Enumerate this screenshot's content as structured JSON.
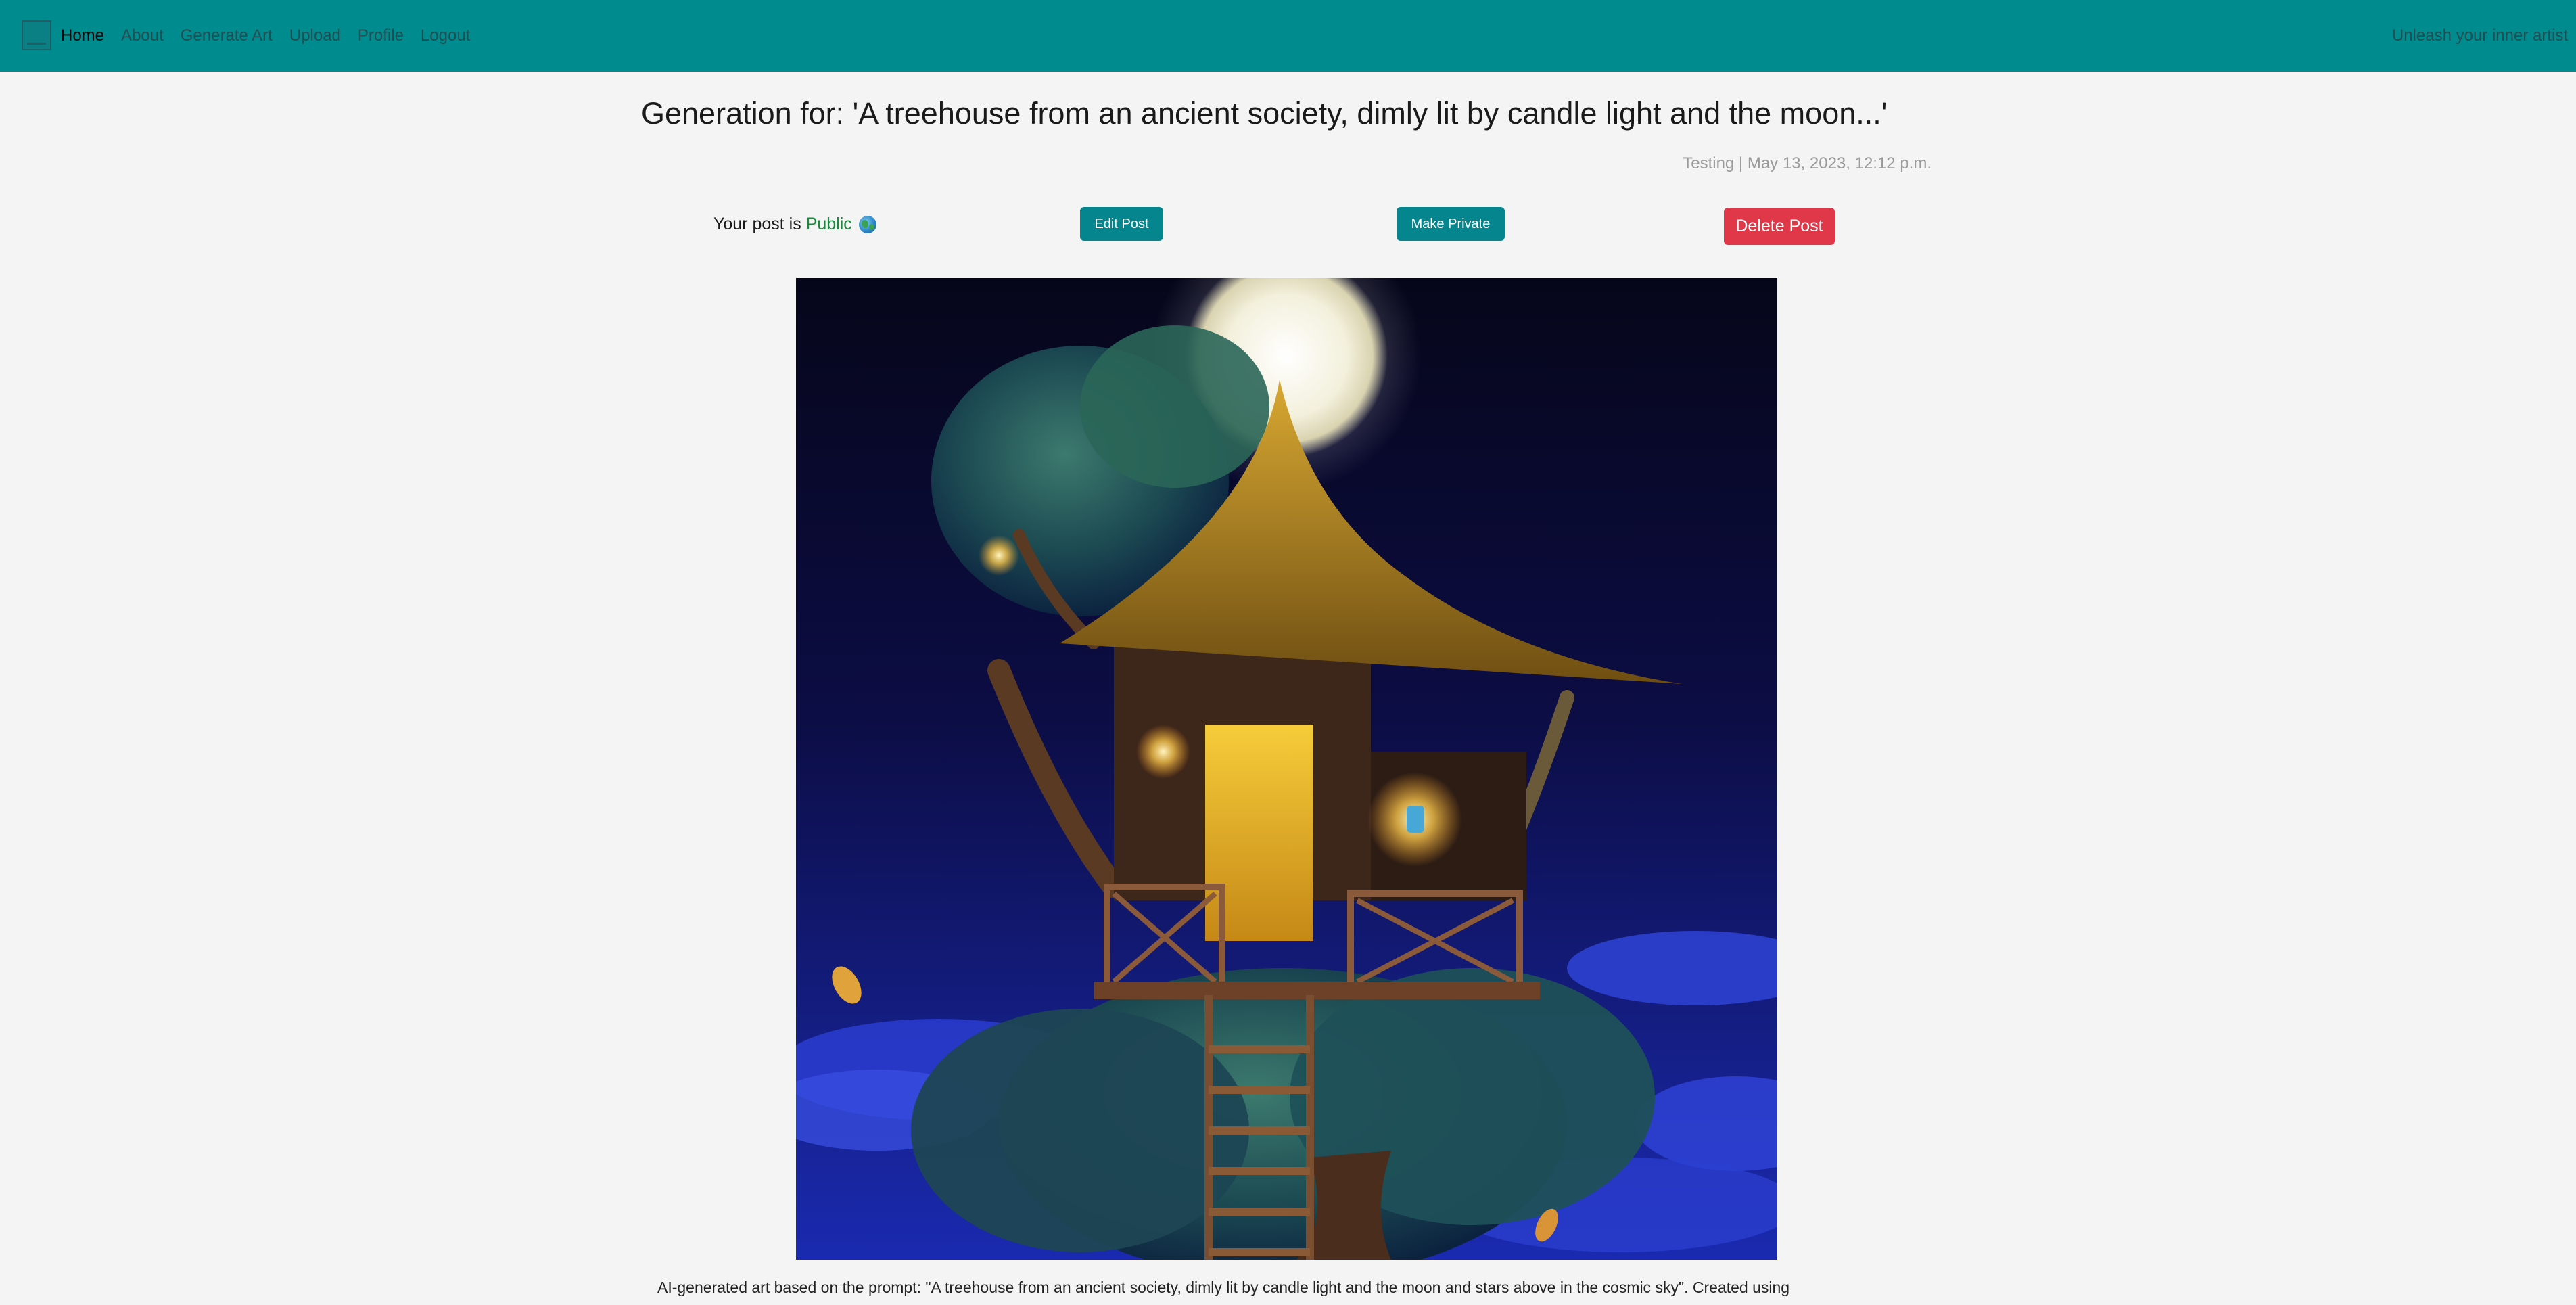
{
  "nav": {
    "links": [
      "Home",
      "About",
      "Generate Art",
      "Upload",
      "Profile",
      "Logout"
    ],
    "tagline": "Unleash your inner artist"
  },
  "post": {
    "title": "Generation for: 'A treehouse from an ancient society, dimly lit by candle light and the moon...'",
    "meta": "Testing | May 13, 2023, 12:12 p.m.",
    "status_prefix": "Your post is",
    "status_value": "Public",
    "edit_label": "Edit Post",
    "private_label": "Make Private",
    "delete_label": "Delete Post",
    "caption": "AI-generated art based on the prompt: \"A treehouse from an ancient society, dimly lit by candle light and the moon and stars above in the cosmic sky\". Created using"
  },
  "icons": {
    "brand": "app-logo-icon",
    "globe": "globe-icon"
  },
  "colors": {
    "navbar": "#008b8f",
    "button_primary": "#05868e",
    "button_danger": "#e03848",
    "public_text": "#1a8a3c"
  }
}
